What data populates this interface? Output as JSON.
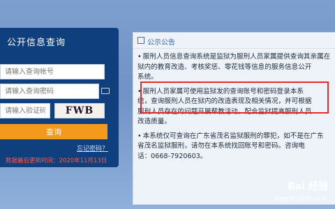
{
  "login": {
    "title": "公开信息查询",
    "account_placeholder": "请输入查询帐号",
    "password_placeholder": "请输入查询密码",
    "captcha_placeholder": "请输入验证码",
    "captcha_text": "FWB",
    "query_label": "查询",
    "forgot_label": "忘记密码？",
    "update_time": "数据最后更新时间：2020年11月13日"
  },
  "notice": {
    "title": "公示公告",
    "paragraphs": [
      "服刑人员信息查询系统是监狱为服刑人员家属提供查询其亲属在",
      "狱内的教育改造、考核奖惩、零花钱等信息的服务信息公开",
      "系统。",
      "服刑人员家属可使用监狱发的查询账号和密码登录本系",
      "统，查询服刑人员在狱内的改造表现及相关情况，并可根据",
      "服刑人员存在的问题开展帮教活动，配合监狱提高服刑人员",
      "改造质量。",
      "本系统仅可查询在广东省茂名监狱服刑的罪犯，如不是在广东",
      "省茂名监狱服刑，请勿在本系统找回账号和密码。咨询电",
      "话：0668-7920603。"
    ]
  },
  "watermark": {
    "brand": "Bai 经验",
    "url": "jingyan.baidu.com"
  }
}
